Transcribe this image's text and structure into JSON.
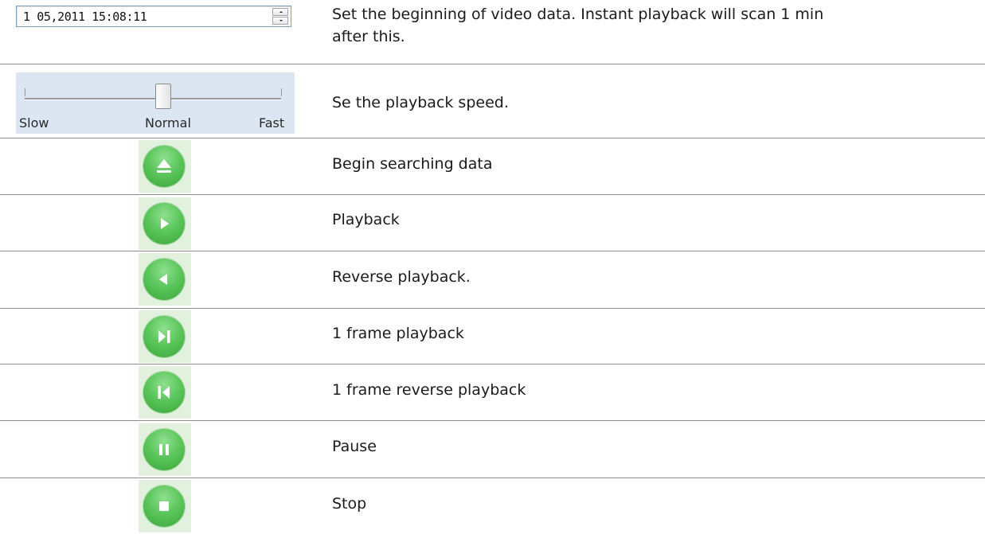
{
  "datetime": {
    "value": "1 05,2011 15:08:11",
    "description_line1": "Set the beginning of video data. Instant playback will scan 1 min",
    "description_line2": "after this."
  },
  "speed": {
    "labels": [
      "Slow",
      "Normal",
      "Fast"
    ],
    "level": "Normal",
    "description": "Se the playback speed."
  },
  "controls": [
    {
      "icon": "eject-icon",
      "description": "Begin searching data"
    },
    {
      "icon": "play-icon",
      "description": "Playback"
    },
    {
      "icon": "reverse-play-icon",
      "description": "Reverse playback."
    },
    {
      "icon": "step-forward-icon",
      "description": "1 frame playback"
    },
    {
      "icon": "step-back-icon",
      "description": "1 frame reverse playback"
    },
    {
      "icon": "pause-icon",
      "description": "Pause"
    },
    {
      "icon": "stop-icon",
      "description": "Stop"
    }
  ],
  "colors": {
    "button_green": "#4cbb4c",
    "slider_panel": "#dce6f2",
    "divider": "#8c8c8c"
  }
}
